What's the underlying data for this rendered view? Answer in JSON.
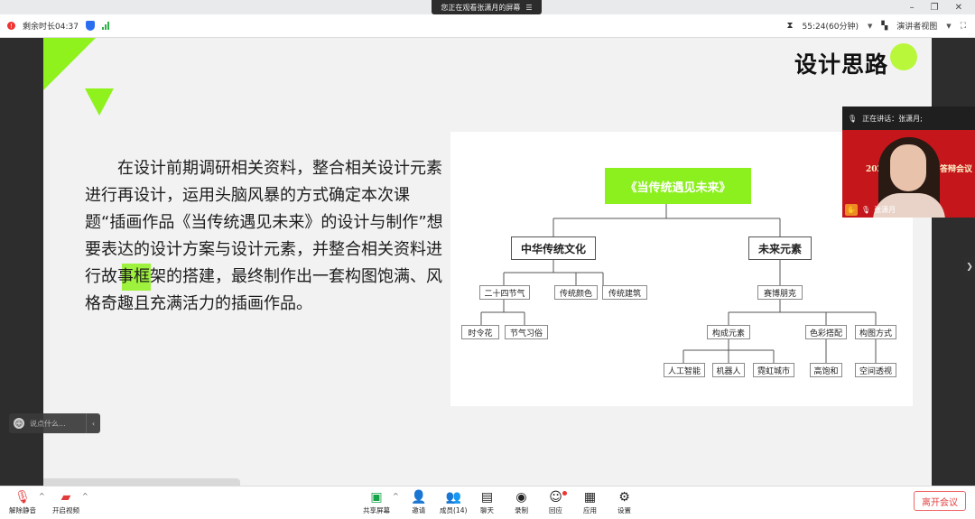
{
  "share_banner": {
    "text": "您正在观看张潇月的屏幕",
    "menu_icon": "hamburger-icon"
  },
  "top_left": {
    "remaining_label": "剩余时长04:37"
  },
  "top_right": {
    "timer": "55:24(60分钟)",
    "view_mode": "演讲者视图"
  },
  "slide": {
    "title": "设计思路",
    "paragraph": "在设计前期调研相关资料，整合相关设计元素进行再设计，运用头脑风暴的方式确定本次课题“插画作品《当传统遇见未来》的设计与制作”想要表达的设计方案与设计元素，并整合相关资料进行故事框架的搭建，最终制作出一套构图饱满、风格奇趣且充满活力的插画作品。",
    "accent_color": "#8ff21d",
    "mindmap": {
      "root": "《当传统遇见未来》",
      "branch_left": "中华传统文化",
      "branch_right": "未来元素",
      "left_children": [
        "二十四节气",
        "传统颜色",
        "传统建筑"
      ],
      "solar_terms_children": [
        "时令花",
        "节气习俗"
      ],
      "right_child": "赛博朋克",
      "cyber_children": [
        "构成元素",
        "色彩搭配",
        "构图方式"
      ],
      "element_children": [
        "人工智能",
        "机器人",
        "霓虹城市"
      ],
      "color_children": [
        "高饱和"
      ],
      "composition_children": [
        "空间透视"
      ]
    }
  },
  "video_tile": {
    "speaking_label": "正在讲话：张潇月;",
    "name": "张潇月",
    "banner_left": "2024届",
    "banner_right": "答辩会议"
  },
  "chat": {
    "placeholder": "说点什么..."
  },
  "toolbar": {
    "unmute": "解除静音",
    "start_video": "开启视频",
    "share_screen": "共享屏幕",
    "invite": "邀请",
    "members": "成员(14)",
    "chat": "聊天",
    "record": "录制",
    "reactions": "回应",
    "apps": "应用",
    "settings": "设置",
    "leave": "离开会议"
  }
}
